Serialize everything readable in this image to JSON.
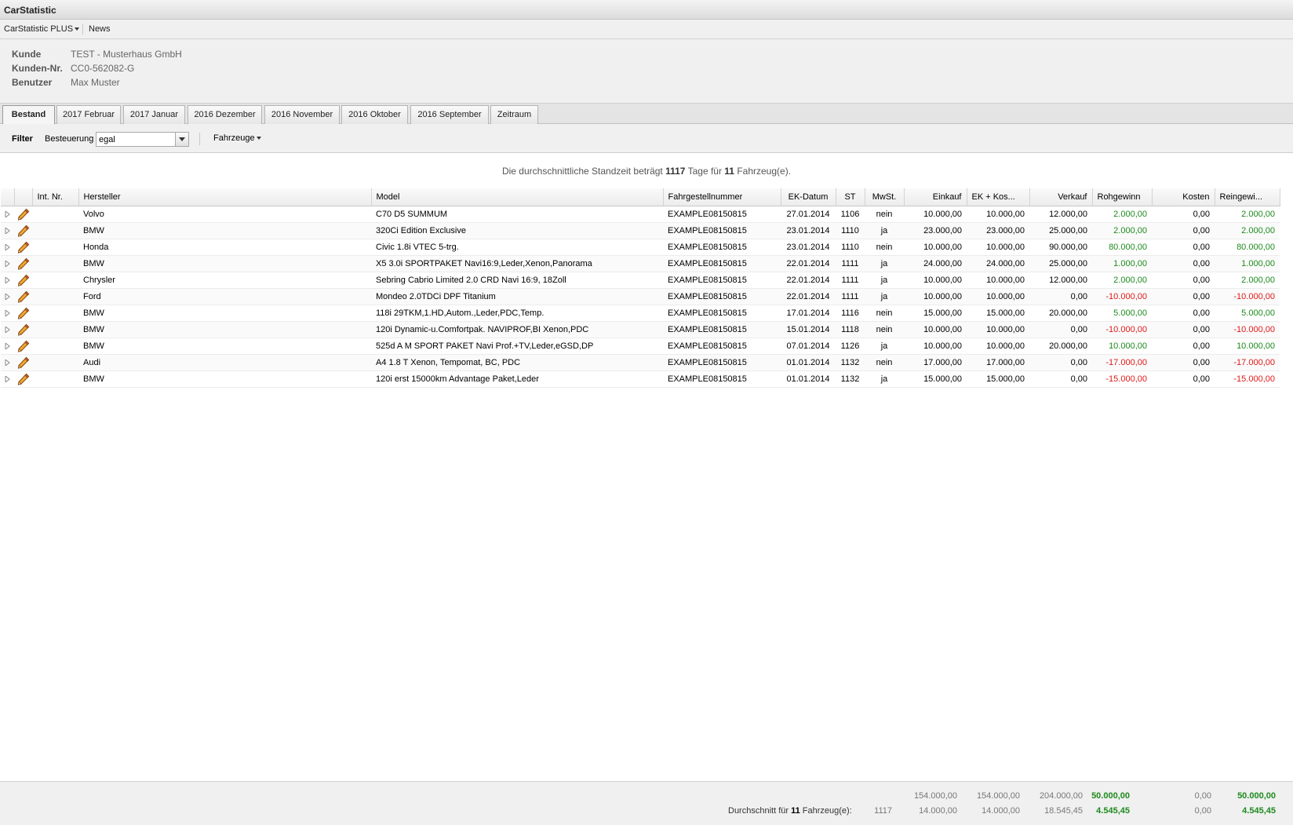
{
  "app_title": "CarStatistic",
  "menu": {
    "plus": "CarStatistic PLUS",
    "news": "News"
  },
  "info": {
    "kunde_label": "Kunde",
    "kunde_value": "TEST - Musterhaus GmbH",
    "kundennr_label": "Kunden-Nr.",
    "kundennr_value": "CC0-562082-G",
    "benutzer_label": "Benutzer",
    "benutzer_value": "Max Muster"
  },
  "tabs": [
    "Bestand",
    "2017 Februar",
    "2017 Januar",
    "2016 Dezember",
    "2016 November",
    "2016 Oktober",
    "2016 September",
    "Zeitraum"
  ],
  "filter": {
    "label": "Filter",
    "besteuerung_label": "Besteuerung",
    "besteuerung_value": "egal",
    "fahrzeuge": "Fahrzeuge"
  },
  "summary": {
    "prefix": "Die durchschnittliche Standzeit beträgt",
    "days": "1117",
    "middle": "Tage für",
    "count": "11",
    "suffix": "Fahrzeug(e)."
  },
  "columns": {
    "intnr": "Int. Nr.",
    "hersteller": "Hersteller",
    "model": "Model",
    "fgn": "Fahrgestellnummer",
    "datum": "EK-Datum",
    "st": "ST",
    "mwst": "MwSt.",
    "einkauf": "Einkauf",
    "ekkos": "EK + Kos...",
    "verkauf": "Verkauf",
    "rohgewinn": "Rohgewinn",
    "kosten": "Kosten",
    "reingewinn": "Reingewi..."
  },
  "rows": [
    {
      "intnr": "",
      "hersteller": "Volvo",
      "model": "C70 D5 SUMMUM",
      "fgn": "EXAMPLE08150815",
      "datum": "27.01.2014",
      "st": "1106",
      "mwst": "nein",
      "einkauf": "10.000,00",
      "ekkos": "10.000,00",
      "verkauf": "12.000,00",
      "rohgewinn": "2.000,00",
      "kosten": "0,00",
      "reingewinn": "2.000,00"
    },
    {
      "intnr": "",
      "hersteller": "BMW",
      "model": "320Ci Edition Exclusive",
      "fgn": "EXAMPLE08150815",
      "datum": "23.01.2014",
      "st": "1110",
      "mwst": "ja",
      "einkauf": "23.000,00",
      "ekkos": "23.000,00",
      "verkauf": "25.000,00",
      "rohgewinn": "2.000,00",
      "kosten": "0,00",
      "reingewinn": "2.000,00"
    },
    {
      "intnr": "",
      "hersteller": "Honda",
      "model": "Civic 1.8i VTEC 5-trg.",
      "fgn": "EXAMPLE08150815",
      "datum": "23.01.2014",
      "st": "1110",
      "mwst": "nein",
      "einkauf": "10.000,00",
      "ekkos": "10.000,00",
      "verkauf": "90.000,00",
      "rohgewinn": "80.000,00",
      "kosten": "0,00",
      "reingewinn": "80.000,00"
    },
    {
      "intnr": "",
      "hersteller": "BMW",
      "model": "X5 3.0i SPORTPAKET Navi16:9,Leder,Xenon,Panorama",
      "fgn": "EXAMPLE08150815",
      "datum": "22.01.2014",
      "st": "1111",
      "mwst": "ja",
      "einkauf": "24.000,00",
      "ekkos": "24.000,00",
      "verkauf": "25.000,00",
      "rohgewinn": "1.000,00",
      "kosten": "0,00",
      "reingewinn": "1.000,00"
    },
    {
      "intnr": "",
      "hersteller": "Chrysler",
      "model": "Sebring Cabrio Limited 2.0 CRD Navi 16:9, 18Zoll",
      "fgn": "EXAMPLE08150815",
      "datum": "22.01.2014",
      "st": "1111",
      "mwst": "ja",
      "einkauf": "10.000,00",
      "ekkos": "10.000,00",
      "verkauf": "12.000,00",
      "rohgewinn": "2.000,00",
      "kosten": "0,00",
      "reingewinn": "2.000,00"
    },
    {
      "intnr": "",
      "hersteller": "Ford",
      "model": "Mondeo 2.0TDCi DPF Titanium",
      "fgn": "EXAMPLE08150815",
      "datum": "22.01.2014",
      "st": "1111",
      "mwst": "ja",
      "einkauf": "10.000,00",
      "ekkos": "10.000,00",
      "verkauf": "0,00",
      "rohgewinn": "-10.000,00",
      "kosten": "0,00",
      "reingewinn": "-10.000,00"
    },
    {
      "intnr": "",
      "hersteller": "BMW",
      "model": "118i 29TKM,1.HD,Autom.,Leder,PDC,Temp.",
      "fgn": "EXAMPLE08150815",
      "datum": "17.01.2014",
      "st": "1116",
      "mwst": "nein",
      "einkauf": "15.000,00",
      "ekkos": "15.000,00",
      "verkauf": "20.000,00",
      "rohgewinn": "5.000,00",
      "kosten": "0,00",
      "reingewinn": "5.000,00"
    },
    {
      "intnr": "",
      "hersteller": "BMW",
      "model": "120i Dynamic-u.Comfortpak. NAVIPROF,BI Xenon,PDC",
      "fgn": "EXAMPLE08150815",
      "datum": "15.01.2014",
      "st": "1118",
      "mwst": "nein",
      "einkauf": "10.000,00",
      "ekkos": "10.000,00",
      "verkauf": "0,00",
      "rohgewinn": "-10.000,00",
      "kosten": "0,00",
      "reingewinn": "-10.000,00"
    },
    {
      "intnr": "",
      "hersteller": "BMW",
      "model": "525d A M SPORT PAKET Navi Prof.+TV,Leder,eGSD,DP",
      "fgn": "EXAMPLE08150815",
      "datum": "07.01.2014",
      "st": "1126",
      "mwst": "ja",
      "einkauf": "10.000,00",
      "ekkos": "10.000,00",
      "verkauf": "20.000,00",
      "rohgewinn": "10.000,00",
      "kosten": "0,00",
      "reingewinn": "10.000,00"
    },
    {
      "intnr": "",
      "hersteller": "Audi",
      "model": "A4 1.8 T Xenon, Tempomat, BC, PDC",
      "fgn": "EXAMPLE08150815",
      "datum": "01.01.2014",
      "st": "1132",
      "mwst": "nein",
      "einkauf": "17.000,00",
      "ekkos": "17.000,00",
      "verkauf": "0,00",
      "rohgewinn": "-17.000,00",
      "kosten": "0,00",
      "reingewinn": "-17.000,00"
    },
    {
      "intnr": "",
      "hersteller": "BMW",
      "model": "120i erst 15000km Advantage Paket,Leder",
      "fgn": "EXAMPLE08150815",
      "datum": "01.01.2014",
      "st": "1132",
      "mwst": "ja",
      "einkauf": "15.000,00",
      "ekkos": "15.000,00",
      "verkauf": "0,00",
      "rohgewinn": "-15.000,00",
      "kosten": "0,00",
      "reingewinn": "-15.000,00"
    }
  ],
  "totals": {
    "einkauf": "154.000,00",
    "ekkos": "154.000,00",
    "verkauf": "204.000,00",
    "rohgewinn": "50.000,00",
    "kosten": "0,00",
    "reingewinn": "50.000,00"
  },
  "average": {
    "label_prefix": "Durchschnitt für",
    "count": "11",
    "label_suffix": "Fahrzeug(e):",
    "st": "1117",
    "einkauf": "14.000,00",
    "ekkos": "14.000,00",
    "verkauf": "18.545,45",
    "rohgewinn": "4.545,45",
    "kosten": "0,00",
    "reingewinn": "4.545,45"
  },
  "colors": {
    "positive": "#1d8a1d",
    "negative": "#e01818"
  }
}
